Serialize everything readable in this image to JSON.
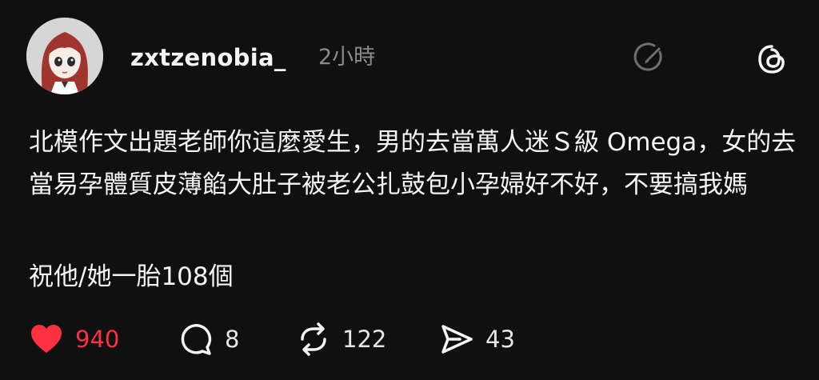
{
  "post": {
    "username": "zxtzenobia_",
    "time": "2小時",
    "text": "北模作文出題老師你這麼愛生，男的去當萬人迷Ｓ級 Omega，女的去當易孕體質皮薄餡大肚子被老公扎鼓包小孕婦好不好，不要搞我媽",
    "text2": "祝他/她一胎108個"
  },
  "actions": {
    "likes": "940",
    "comments": "8",
    "reposts": "122",
    "shares": "43"
  },
  "colors": {
    "background": "#101010",
    "text": "#f3f5f7",
    "muted": "#8a8a8a",
    "like": "#ff3040"
  },
  "icons": [
    "avatar",
    "edit-icon",
    "threads-logo-icon",
    "heart-icon",
    "comment-icon",
    "repost-icon",
    "share-icon"
  ]
}
